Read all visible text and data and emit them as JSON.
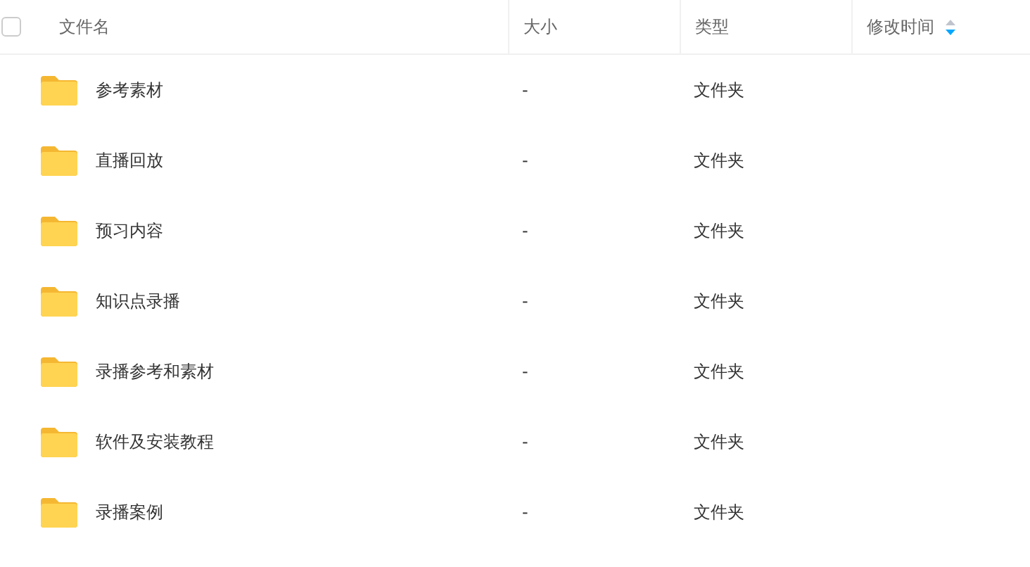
{
  "header": {
    "select_all": {
      "checked": false
    },
    "columns": [
      {
        "label": "文件名",
        "sortable": false
      },
      {
        "label": "大小",
        "sortable": false
      },
      {
        "label": "类型",
        "sortable": false
      },
      {
        "label": "修改时间",
        "sortable": true
      }
    ]
  },
  "rows": [
    {
      "name": "参考素材",
      "size": "-",
      "type": "文件夹",
      "selected": false
    },
    {
      "name": "直播回放",
      "size": "-",
      "type": "文件夹",
      "selected": false
    },
    {
      "name": "预习内容",
      "size": "-",
      "type": "文件夹",
      "selected": false
    },
    {
      "name": "知识点录播",
      "size": "-",
      "type": "文件夹",
      "selected": false
    },
    {
      "name": "录播参考和素材",
      "size": "-",
      "type": "文件夹",
      "selected": false
    },
    {
      "name": "软件及安装教程",
      "size": "-",
      "type": "文件夹",
      "selected": false
    },
    {
      "name": "录播案例",
      "size": "-",
      "type": "文件夹",
      "selected": false
    }
  ]
}
